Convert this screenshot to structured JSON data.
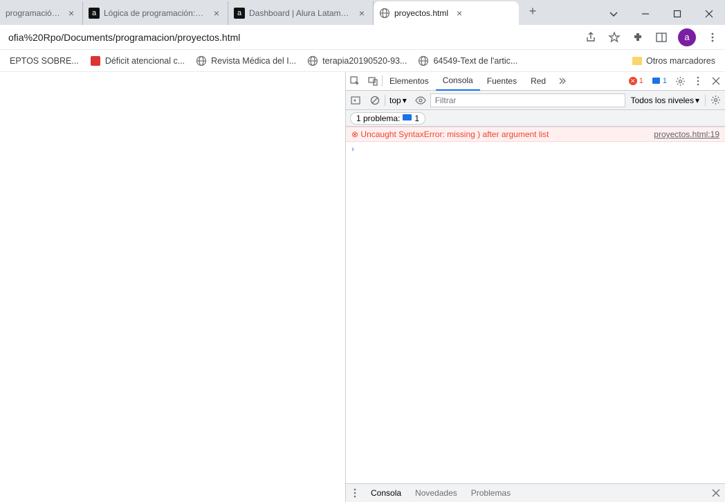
{
  "tabs": [
    {
      "title": "programación: Pri",
      "favicon": "none"
    },
    {
      "title": "Lógica de programación: Pri",
      "favicon": "alura"
    },
    {
      "title": "Dashboard | Alura Latam - C",
      "favicon": "alura"
    },
    {
      "title": "proyectos.html",
      "favicon": "globe",
      "active": true
    }
  ],
  "window": {
    "avatar_letter": "a"
  },
  "address": {
    "url": "ofia%20Rpo/Documents/programacion/proyectos.html"
  },
  "bookmarks": {
    "items": [
      {
        "label": "EPTOS SOBRE...",
        "icon": "none"
      },
      {
        "label": "Déficit atencional c...",
        "icon": "red"
      },
      {
        "label": "Revista Médica del I...",
        "icon": "globe"
      },
      {
        "label": "terapia20190520-93...",
        "icon": "globe"
      },
      {
        "label": "64549-Text de l'artic...",
        "icon": "globe"
      }
    ],
    "other": "Otros marcadores"
  },
  "devtools": {
    "tabs": {
      "elements": "Elementos",
      "console": "Consola",
      "sources": "Fuentes",
      "network": "Red"
    },
    "badges": {
      "errors": "1",
      "issues": "1"
    },
    "toolbar": {
      "context": "top",
      "filter_placeholder": "Filtrar",
      "levels": "Todos los niveles"
    },
    "issues_bar": {
      "label": "1 problema:",
      "count": "1"
    },
    "error": {
      "icon": "⊗",
      "message": "Uncaught SyntaxError: missing ) after argument list",
      "source": "proyectos.html:19"
    },
    "prompt": "›",
    "drawer": {
      "console": "Consola",
      "whatsnew": "Novedades",
      "issues": "Problemas"
    }
  }
}
